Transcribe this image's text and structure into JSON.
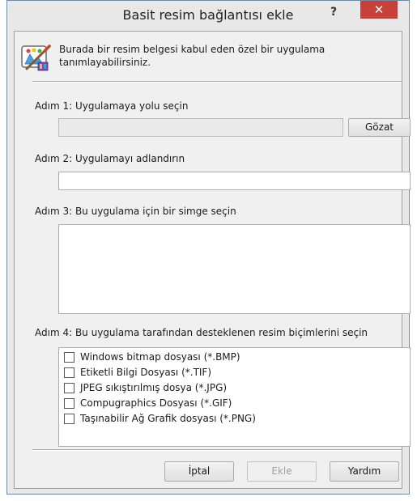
{
  "window": {
    "title": "Basit resim bağlantısı ekle",
    "help_glyph": "?",
    "close_glyph": "✕"
  },
  "intro": {
    "icon": "paint-palette-brush-icon",
    "line1": "Burada bir resim belgesi kabul eden özel bir uygulama",
    "line2": "tanımlayabilirsiniz."
  },
  "step1": {
    "label": "Adım 1: Uygulamaya yolu seçin",
    "path_value": "",
    "browse_label": "Gözat"
  },
  "step2": {
    "label": "Adım 2: Uygulamayı adlandırın",
    "name_value": ""
  },
  "step3": {
    "label": "Adım 3: Bu uygulama için bir simge seçin"
  },
  "step4": {
    "label": "Adım 4: Bu uygulama tarafından desteklenen resim biçimlerini seçin",
    "formats": [
      {
        "label": "Windows bitmap dosyası (*.BMP)",
        "checked": false
      },
      {
        "label": "Etiketli Bilgi Dosyası (*.TIF)",
        "checked": false
      },
      {
        "label": "JPEG sıkıştırılmış dosya (*.JPG)",
        "checked": false
      },
      {
        "label": "Compugraphics Dosyası (*.GIF)",
        "checked": false
      },
      {
        "label": "Taşınabilir Ağ Grafik dosyası (*.PNG)",
        "checked": false
      }
    ]
  },
  "buttons": {
    "cancel": "İptal",
    "add": "Ekle",
    "help": "Yardım"
  },
  "colors": {
    "close_button": "#c7403a",
    "dialog_bg": "#f0f0f0",
    "frame": "#e8e8e8"
  }
}
